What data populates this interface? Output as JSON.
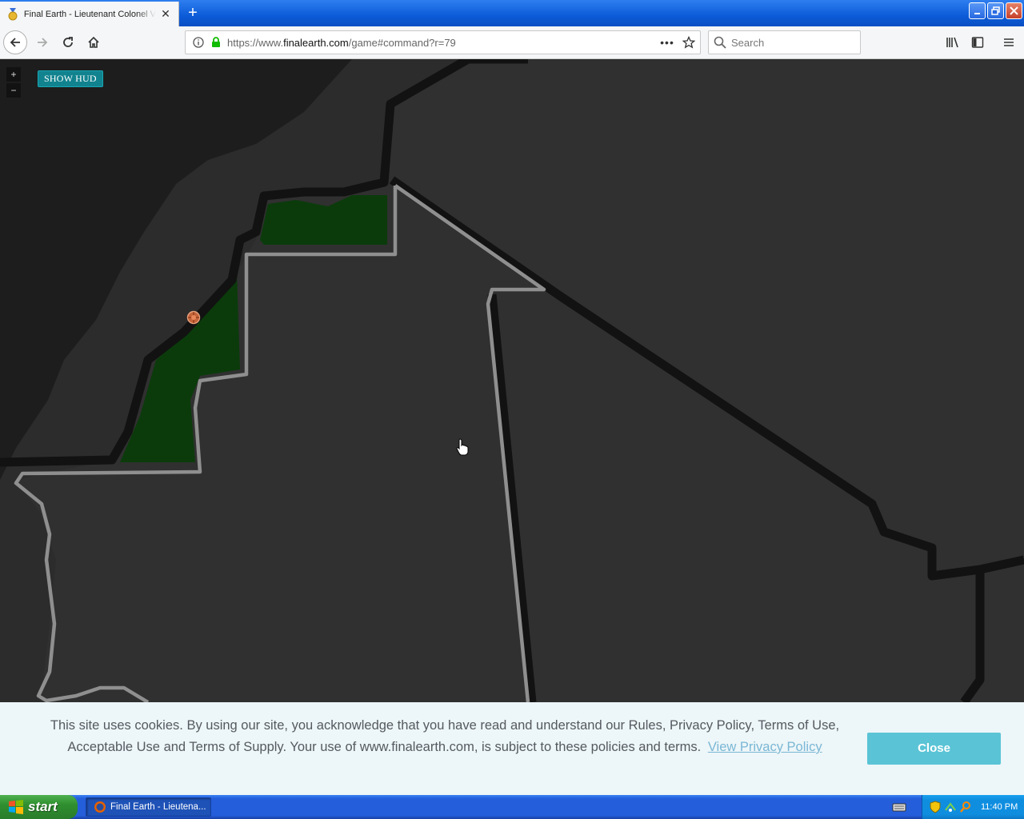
{
  "browser": {
    "tab_title": "Final Earth - Lieutenant Colonel Vi",
    "url_prefix": "https://www.",
    "url_domain": "finalearth.com",
    "url_path": "/game#command?r=79",
    "search_placeholder": "Search"
  },
  "map": {
    "zoom_in_label": "+",
    "zoom_out_label": "−",
    "show_hud_label": "SHOW HUD",
    "colors": {
      "ocean": "#1d1d1d",
      "coast": "#2c2c2c",
      "land": "#2f2f2f",
      "owned_territory": "#0d3a0d",
      "border_dark": "#111111",
      "border_light": "#8a8a8a"
    }
  },
  "cookie_banner": {
    "message": "This site uses cookies. By using our site, you acknowledge that you have read and understand our Rules, Privacy Policy, Terms of Use, Acceptable Use and Terms of Supply. Your use of www.finalearth.com, is subject to these policies and terms.",
    "link_label": "View Privacy Policy",
    "close_label": "Close"
  },
  "taskbar": {
    "start_label": "start",
    "task_label": "Final Earth - Lieutena...",
    "clock": "11:40 PM"
  }
}
